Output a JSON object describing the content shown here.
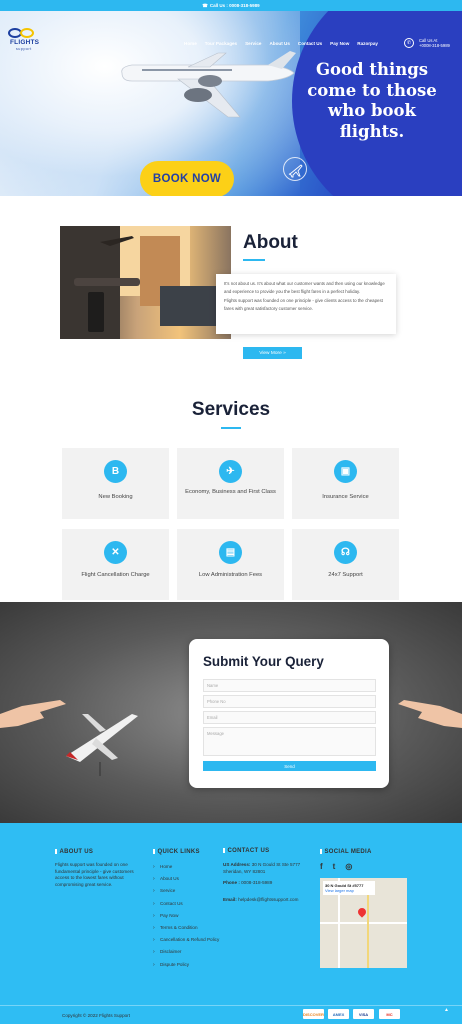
{
  "topbar": {
    "text": "Call Us : 0008-318-5989"
  },
  "header": {
    "logo_main": "FLIGHTS",
    "logo_sub": "support",
    "nav": [
      "Home",
      "Tour Packages",
      "Service",
      "About Us",
      "Contact Us",
      "Pay Now",
      "Razorpay"
    ],
    "call_label": "Call Us At",
    "call_number": "+0008-318-5989"
  },
  "hero": {
    "headline": "Good things come to those who book flights.",
    "cta": "BOOK NOW"
  },
  "about": {
    "title": "About",
    "text1": "It's not about us. It's about what our customer wants and then using our knowledge and experience to provide you the best flight fares in a perfect holiday.",
    "text2": "Flights support was founded on one principle - give clients access to the cheapest fares with great satisfactory customer service.",
    "button": "View More »"
  },
  "services": {
    "title": "Services",
    "items": [
      {
        "label": "New Booking",
        "icon": "booking-icon"
      },
      {
        "label": "Economy, Business and First Class",
        "icon": "airplane-icon"
      },
      {
        "label": "Insurance Service",
        "icon": "briefcase-icon"
      },
      {
        "label": "Flight Cancellation Charge",
        "icon": "cancel-icon"
      },
      {
        "label": "Low Administration Fees",
        "icon": "card-icon"
      },
      {
        "label": "24x7 Support",
        "icon": "headset-icon"
      }
    ]
  },
  "query": {
    "title": "Submit Your Query",
    "name_ph": "Name",
    "phone_ph": "Phone No",
    "email_ph": "Email",
    "message_ph": "Message",
    "send": "Send"
  },
  "footer": {
    "about_title": "ABOUT US",
    "about_text": "Flights support was founded on one fundamental principle - give customers access to the lowest fares without compromising great service.",
    "links_title": "QUICK LINKS",
    "links": [
      "Home",
      "About Us",
      "Service",
      "Contact Us",
      "Pay Now",
      "Terms & Condition",
      "Cancellation & Refund Policy",
      "Disclaimer",
      "Dispute Policy"
    ],
    "contact_title": "CONTACT US",
    "address_label": "US Address:",
    "address": "30 N Gould St Ste 5777 Sheridan, WY 82801",
    "phone_label": "Phone :",
    "phone": "0008-318-5989",
    "email_label": "Email:",
    "email": "helpdesk@flightssupport.com",
    "social_title": "SOCIAL MEDIA",
    "map_label": "30 N Gould St #5777",
    "map_link": "View larger map",
    "copyright": "Copyright © 2022 Flights Support",
    "payments": [
      "DISCOVER",
      "AMEX",
      "VISA",
      "MC"
    ]
  }
}
